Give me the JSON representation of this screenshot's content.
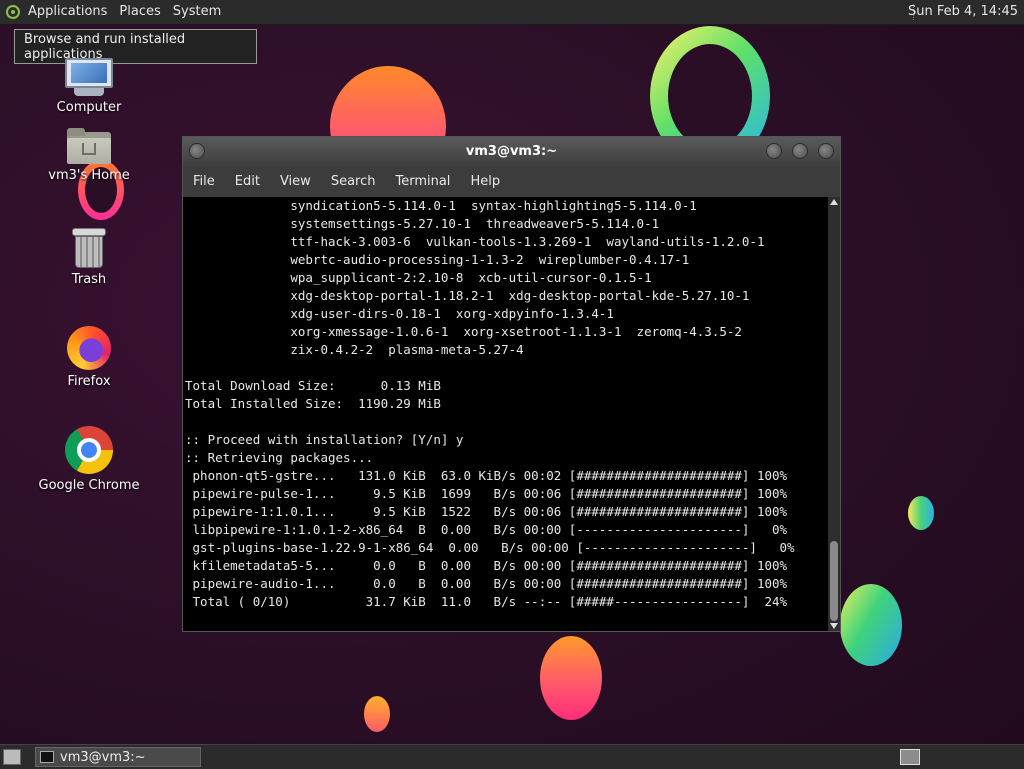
{
  "top_panel": {
    "menus": [
      "Applications",
      "Places",
      "System"
    ],
    "clock": "Sun Feb  4, 14:45"
  },
  "tooltip": "Browse and run installed applications",
  "desktop_icons": [
    {
      "label": "Computer",
      "icon": "computer-icon"
    },
    {
      "label": "vm3's Home",
      "icon": "home-folder-icon"
    },
    {
      "label": "Trash",
      "icon": "trash-icon"
    },
    {
      "label": "Firefox",
      "icon": "firefox-icon"
    },
    {
      "label": "Google Chrome",
      "icon": "chrome-icon"
    }
  ],
  "window": {
    "title": "vm3@vm3:~",
    "menu": [
      "File",
      "Edit",
      "View",
      "Search",
      "Terminal",
      "Help"
    ],
    "lines": [
      "              syndication5-5.114.0-1  syntax-highlighting5-5.114.0-1",
      "              systemsettings-5.27.10-1  threadweaver5-5.114.0-1",
      "              ttf-hack-3.003-6  vulkan-tools-1.3.269-1  wayland-utils-1.2.0-1",
      "              webrtc-audio-processing-1-1.3-2  wireplumber-0.4.17-1",
      "              wpa_supplicant-2:2.10-8  xcb-util-cursor-0.1.5-1",
      "              xdg-desktop-portal-1.18.2-1  xdg-desktop-portal-kde-5.27.10-1",
      "              xdg-user-dirs-0.18-1  xorg-xdpyinfo-1.3.4-1",
      "              xorg-xmessage-1.0.6-1  xorg-xsetroot-1.1.3-1  zeromq-4.3.5-2",
      "              zix-0.4.2-2  plasma-meta-5.27-4",
      "",
      "Total Download Size:      0.13 MiB",
      "Total Installed Size:  1190.29 MiB",
      "",
      ":: Proceed with installation? [Y/n] y",
      ":: Retrieving packages...",
      " phonon-qt5-gstre...   131.0 KiB  63.0 KiB/s 00:02 [######################] 100%",
      " pipewire-pulse-1...     9.5 KiB  1699   B/s 00:06 [######################] 100%",
      " pipewire-1:1.0.1...     9.5 KiB  1522   B/s 00:06 [######################] 100%",
      " libpipewire-1:1.0.1-2-x86_64  B  0.00   B/s 00:00 [----------------------]   0%",
      " gst-plugins-base-1.22.9-1-x86_64  0.00   B/s 00:00 [----------------------]   0%",
      " kfilemetadata5-5...     0.0   B  0.00   B/s 00:00 [######################] 100%",
      " pipewire-audio-1...     0.0   B  0.00   B/s 00:00 [######################] 100%",
      " Total ( 0/10)          31.7 KiB  11.0   B/s --:-- [#####-----------------]  24%"
    ]
  },
  "taskbar": {
    "task_title": "vm3@vm3:~"
  }
}
